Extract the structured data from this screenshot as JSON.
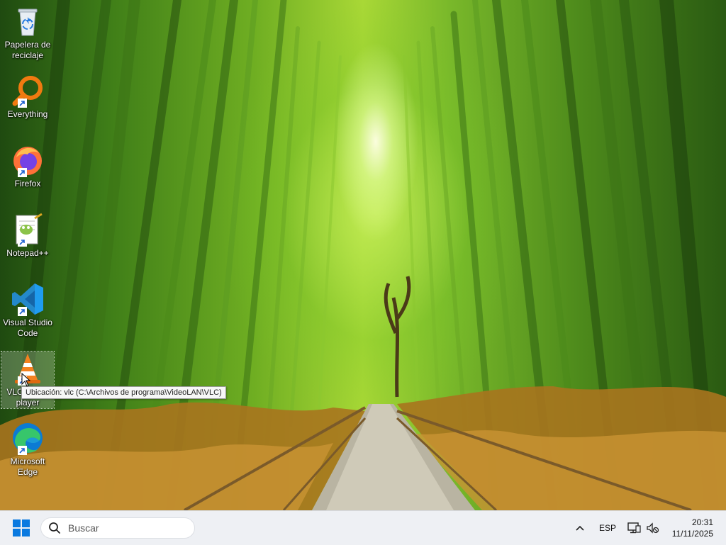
{
  "desktop": {
    "icons": [
      {
        "label": "Papelera de reciclaje",
        "icon": "recycle-bin-icon"
      },
      {
        "label": "Everything",
        "icon": "everything-search-icon"
      },
      {
        "label": "Firefox",
        "icon": "firefox-icon"
      },
      {
        "label": "Notepad++",
        "icon": "notepad-plus-plus-icon"
      },
      {
        "label": "Visual Studio Code",
        "icon": "vscode-icon"
      },
      {
        "label": "VLC media player",
        "icon": "vlc-icon"
      },
      {
        "label": "Microsoft Edge",
        "icon": "edge-icon"
      }
    ],
    "tooltip": "Ubicación: vlc (C:\\Archivos de programa\\VideoLAN\\VLC)"
  },
  "taskbar": {
    "start_icon": "windows-start-icon",
    "search_placeholder": "Buscar",
    "tray": {
      "language": "ESP",
      "time": "20:31",
      "date": "11/11/2025"
    }
  },
  "colors": {
    "taskbar_bg": "#eef0f4",
    "start_blue": "#0a7ae0"
  }
}
